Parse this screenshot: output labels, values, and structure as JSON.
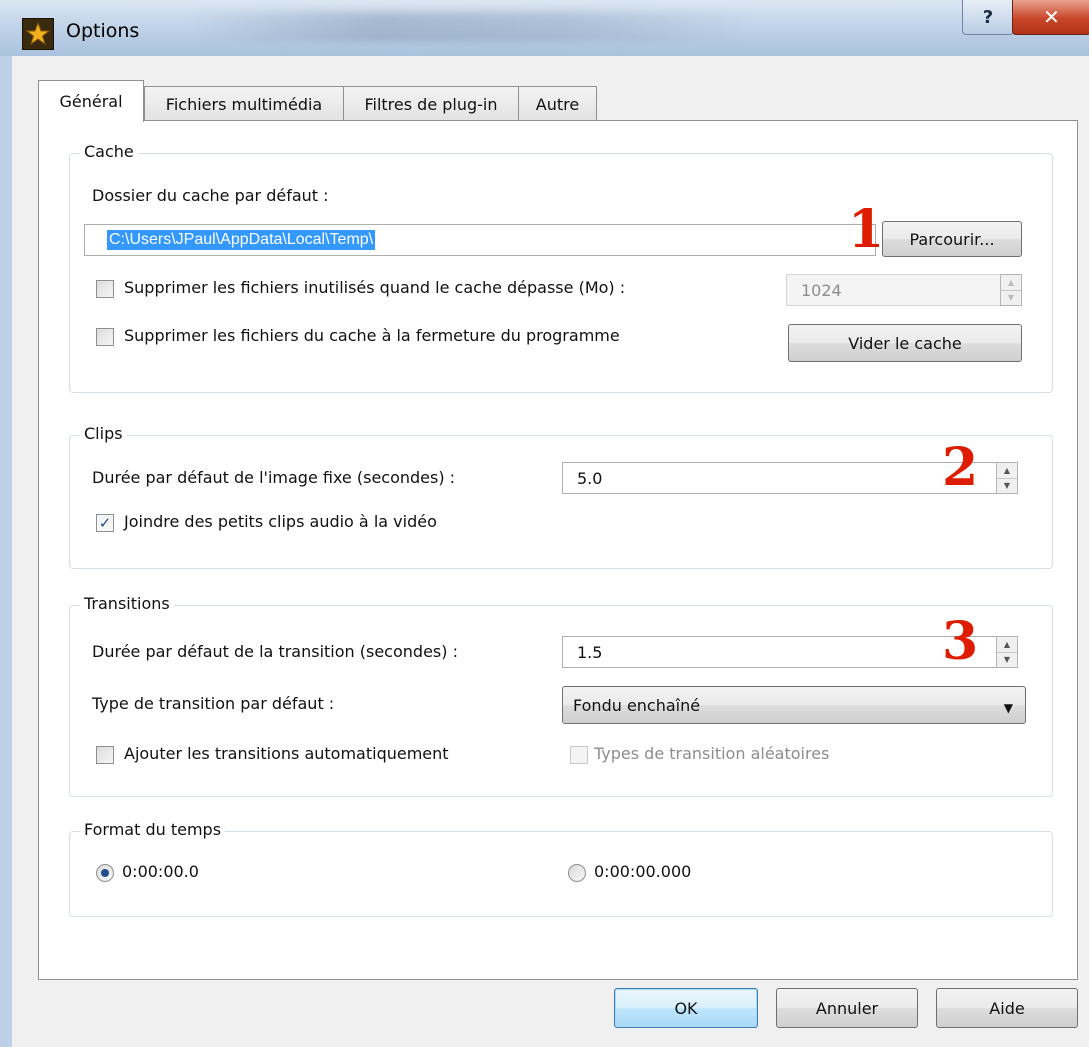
{
  "window": {
    "title": "Options"
  },
  "tabs": [
    {
      "label": "Général"
    },
    {
      "label": "Fichiers multimédia"
    },
    {
      "label": "Filtres de plug-in"
    },
    {
      "label": "Autre"
    }
  ],
  "cache": {
    "group_title": "Cache",
    "folder_label": "Dossier du cache par défaut :",
    "folder_value": "C:\\Users\\JPaul\\AppData\\Local\\Temp\\",
    "browse_button": "Parcourir...",
    "delete_unused_label": "Supprimer les fichiers inutilisés quand le cache dépasse (Mo) :",
    "delete_unused_checked": false,
    "size_value": "1024",
    "delete_on_close_label": "Supprimer les fichiers du cache à la fermeture du programme",
    "delete_on_close_checked": false,
    "clear_button": "Vider le cache"
  },
  "clips": {
    "group_title": "Clips",
    "image_duration_label": "Durée par défaut de l'image fixe (secondes) :",
    "image_duration_value": "5.0",
    "join_audio_label": "Joindre des petits clips audio à la vidéo",
    "join_audio_checked": true
  },
  "transitions": {
    "group_title": "Transitions",
    "duration_label": "Durée par défaut de la transition (secondes) :",
    "duration_value": "1.5",
    "type_label": "Type de transition par défaut :",
    "type_value": "Fondu enchaîné",
    "auto_label": "Ajouter les transitions automatiquement",
    "auto_checked": false,
    "random_label": "Types de transition aléatoires",
    "random_checked": false
  },
  "time_format": {
    "group_title": "Format du temps",
    "option1": "0:00:00.0",
    "option2": "0:00:00.000",
    "selected": "0:00:00.0"
  },
  "annotations": [
    "1",
    "2",
    "3"
  ],
  "footer": {
    "ok_label": "OK",
    "cancel_label": "Annuler",
    "help_label": "Aide"
  },
  "colors": {
    "accent_selection": "#3399ff",
    "annotation": "#dd1c00"
  }
}
